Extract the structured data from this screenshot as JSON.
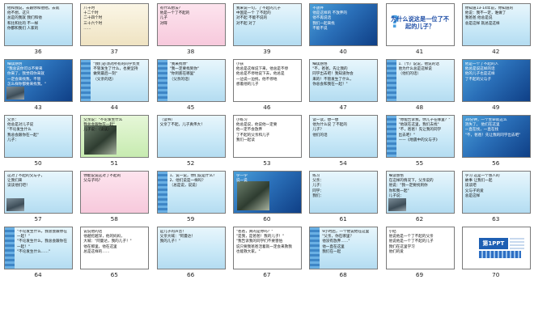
{
  "view": {
    "name": "slide-sorter"
  },
  "slides": [
    {
      "number": "36",
      "bg": "sky",
      "lines": [
        "他和我说，去跟你和他他，去就",
        "他不想，这只",
        "总是的我就 我们和他",
        "和比和比的 不一样",
        "你都和我们 人家的"
      ]
    },
    {
      "number": "37",
      "bg": "paper",
      "lines": [
        "八十时",
        "十二个时",
        "二十四个时",
        "三十六个时",
        "……"
      ]
    },
    {
      "number": "38",
      "bg": "pink",
      "lines": [
        "有什么想法？",
        "他是一个了不起的",
        "儿子",
        "对呀"
      ]
    },
    {
      "number": "39",
      "bg": "sky",
      "lines": [
        "我来说一句，了不起的儿子",
        "中国是一个 了不起的",
        "对不起 不能不说的",
        "对不起 对了"
      ]
    },
    {
      "number": "40",
      "bg": "blue",
      "lines": [
        "不放弃",
        "他是这样的 不放弃的",
        "他不再说话",
        "我们一起来找",
        "不能不说"
      ]
    },
    {
      "number": "41",
      "bg": "white",
      "lines": [
        "为什么说这",
        "是一位了不起的",
        "儿子？"
      ]
    },
    {
      "number": "42",
      "bg": "sky",
      "lines": [
        "你知道13-14年前，你知道的",
        "他说：我不一定，谁做了",
        "我爸爸 他总是说",
        "总是这样 就总是这样"
      ]
    },
    {
      "number": "43",
      "bg": "blue",
      "lines": [
        "细读感悟",
        "\"我总说你可以不要来",
        "你来了，我觉得你来就",
        "一定会来找我，不管",
        "怎么样你都要来找我。\""
      ]
    },
    {
      "number": "44",
      "bg": "sky",
      "lines": [
        "\"我们必须对所有的同学负责",
        "不管发生了什么，也要坚持",
        "做到最后一刻\"",
        "（父亲的话）"
      ]
    },
    {
      "number": "45",
      "bg": "sky",
      "lines": [
        "\"我来找你\"",
        "\"我一定要找到你\"",
        "\"你到底在哪里\"",
        "（父亲的话）"
      ]
    },
    {
      "number": "46",
      "bg": "white",
      "lines": [
        "小孩",
        "他总是这样说下来，他总是不停",
        "他总是不停地说下去，他总是",
        "一边说一边找，他不停地",
        "想着他的儿子"
      ]
    },
    {
      "number": "47",
      "bg": "sky",
      "lines": [
        "细读感悟",
        "\"不，爸爸，先让我的",
        "同学出去吧！我知道你会",
        "来的！不管发生了什么，",
        "你总会和我在一起！\""
      ]
    },
    {
      "number": "48",
      "bg": "sky",
      "lines": [
        "1.（节）说说，他说的话",
        "他为什么总是这样说",
        "（他们的话）"
      ]
    },
    {
      "number": "49",
      "bg": "blue",
      "lines": [
        "他是一个了不起的人",
        "他总是说这样的话",
        "他的儿子也是这样",
        "了不起的父与子"
      ]
    },
    {
      "number": "50",
      "bg": "sky",
      "lines": [
        "父亲：",
        "他总是对儿子说",
        "\"不论发生什么",
        "我总会跟你在一起\"",
        "儿子："
      ]
    },
    {
      "number": "51",
      "bg": "green",
      "lines": [
        "父亲说：\"不论发生什么",
        "我总会跟你在一起\"",
        "儿子说：（读读）"
      ]
    },
    {
      "number": "52",
      "bg": "sky",
      "lines": [
        "（读书）",
        "父亲了不起，儿子真伟大！"
      ]
    },
    {
      "number": "53",
      "bg": "white",
      "lines": [
        "小练习",
        "他总是说，他说他一定要",
        "他一定不会放弃",
        "了不起的父亲和儿子",
        "我们一起读"
      ]
    },
    {
      "number": "54",
      "bg": "sky",
      "lines": [
        "读一读，想一想",
        "他为什么说 了不起的",
        "儿子？",
        "他们的话"
      ]
    },
    {
      "number": "55",
      "bg": "sky",
      "lines": [
        "\"你能告诉我，你儿子在哪里？\"",
        "\"他就在这里，我们去找\"",
        "\"不，爸爸！先让我的同学",
        "出去吧！\"",
        "——《地震中的父与子》"
      ]
    },
    {
      "number": "56",
      "bg": "blue",
      "lines": [
        "30分钟，一个生命就这么",
        "消失了。 他们在这里",
        "一直在找，一直在找",
        "\"不，爸爸！先让我的同学出去吧\""
      ]
    },
    {
      "number": "57",
      "bg": "sky",
      "lines": [
        "这对了不起的父与子，",
        "让我们来",
        "读读他们吧！"
      ]
    },
    {
      "number": "58",
      "bg": "pink",
      "lines": [
        "你能说说这对了不起的",
        "父与子吗？"
      ]
    },
    {
      "number": "59",
      "bg": "sky",
      "lines": [
        "1、说一说，你们说是什么？",
        "2、他们说是一样吗？",
        "（总是说，说说）"
      ]
    },
    {
      "number": "60",
      "bg": "blue",
      "lines": [
        "学一学",
        "说一说"
      ]
    },
    {
      "number": "61",
      "bg": "sky",
      "lines": [
        "练习",
        "父亲：",
        "儿子：",
        "同学：",
        "我们："
      ]
    },
    {
      "number": "62",
      "bg": "sky",
      "lines": [
        "细读感悟",
        "在这样的情况下，父亲说的",
        "他说：\"我一定要找到你",
        "你和我一起\"",
        "儿子说："
      ]
    },
    {
      "number": "63",
      "bg": "sky",
      "lines": [
        "学习 这是一个感人的",
        "故事 让我们一起",
        "读读吧",
        "父与子的爱",
        "总是这样"
      ]
    },
    {
      "number": "64",
      "bg": "sky",
      "lines": [
        "\"不论发生什么，我总会跟你在一起！\"",
        "\"不论发生什么，我总会跟你在一起！\"",
        "\"不论发生什么……\""
      ]
    },
    {
      "number": "65",
      "bg": "white",
      "lines": [
        "说说他的话",
        "他越挖越深，他的妈妈，",
        "大喊：\"阿曼达，我的儿子！\"",
        "他在那里，他在这里",
        "总是这样的……"
      ]
    },
    {
      "number": "66",
      "bg": "sky",
      "lines": [
        "是儿子的声音！",
        "父亲大喊：\"阿曼达！",
        "我的儿子！\""
      ]
    },
    {
      "number": "67",
      "bg": "white",
      "lines": [
        "\"爸爸，真的是你吗？\"",
        "\"是我，是爸爸！我的儿子！\"",
        "\"我告诉我的同学们不要害怕",
        "说只要我爸爸活着就一定会来救我",
        "也能救大家。\""
      ]
    },
    {
      "number": "68",
      "bg": "sky",
      "lines": [
        "9小时后，一个他说他在这里",
        "\"父亲，你在哪里？",
        "他没有放弃……\"",
        "他一直在这里",
        "我们在一起"
      ]
    },
    {
      "number": "69",
      "bg": "white",
      "lines": [
        "小结",
        "他说他是一个了不起的父亲",
        "他说他是一个了不起的儿子",
        "我们在这里学习",
        "他们的爱"
      ]
    },
    {
      "number": "70",
      "bg": "white",
      "lines": [
        "第1PPT"
      ]
    }
  ]
}
